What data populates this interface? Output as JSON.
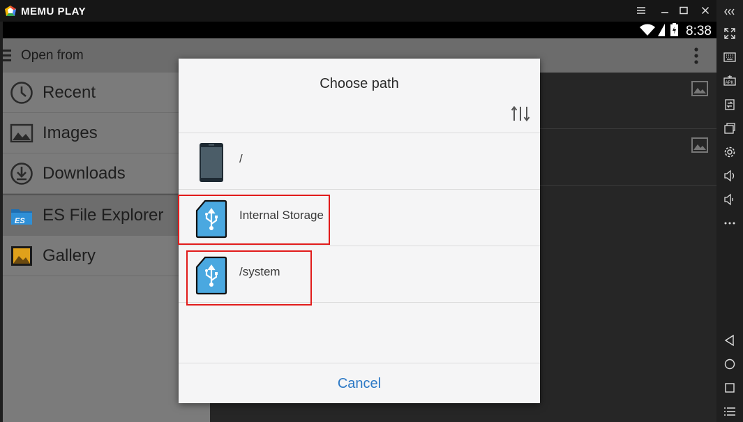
{
  "window": {
    "brand": "MEMU PLAY"
  },
  "status_bar": {
    "time": "8:38"
  },
  "appbar": {
    "title": "Open from"
  },
  "drawer": {
    "items": [
      {
        "label": "Recent",
        "icon": "clock-icon"
      },
      {
        "label": "Images",
        "icon": "image-icon"
      },
      {
        "label": "Downloads",
        "icon": "download-icon"
      },
      {
        "label": "ES File Explorer",
        "icon": "es-file-explorer-icon"
      },
      {
        "label": "Gallery",
        "icon": "gallery-icon"
      }
    ]
  },
  "dialog": {
    "title": "Choose path",
    "sort_icon": "sort-icon",
    "rows": [
      {
        "label": "/",
        "icon": "phone-icon"
      },
      {
        "label": "Internal Storage",
        "icon": "usb-storage-icon"
      },
      {
        "label": "/system",
        "icon": "usb-storage-icon"
      }
    ],
    "cancel_label": "Cancel"
  },
  "colors": {
    "accent": "#2b78c5",
    "highlight": "#e11b1b",
    "storage_icon": "#4aa8e0"
  },
  "sidebar": {
    "icons": [
      "collapse-icon",
      "fullscreen-icon",
      "keyboard-icon",
      "apk-icon",
      "transfer-icon",
      "multi-window-icon",
      "settings-icon",
      "volume-up-icon",
      "volume-down-icon",
      "more-icon",
      "back-icon",
      "home-icon",
      "recents-icon",
      "menu-icon"
    ]
  }
}
